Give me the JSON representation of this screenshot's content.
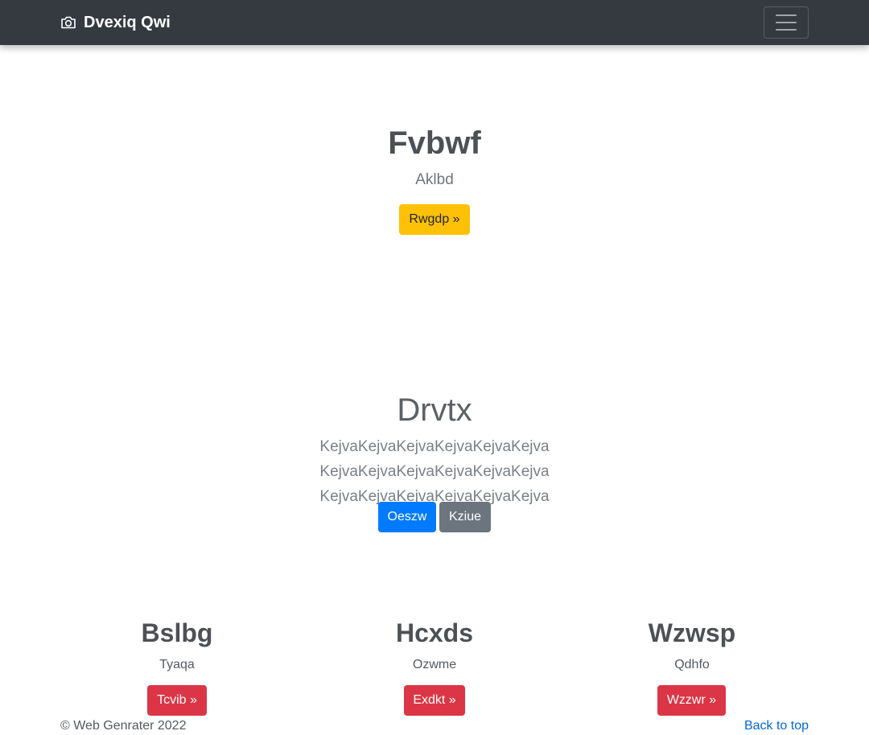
{
  "navbar": {
    "brand": "Dvexiq Qwi",
    "brand_icon": "camera-icon",
    "toggler_icon": "hamburger-menu-icon"
  },
  "hero": {
    "title": "Fvbwf",
    "subtitle": "Aklbd",
    "button": "Rwgdp »"
  },
  "jumbotron": {
    "title": "Drvtx",
    "lead": "KejvaKejvaKejvaKejvaKejvaKejva KejvaKejvaKejvaKejvaKejvaKejva KejvaKejvaKejvaKejvaKejvaKejva",
    "primary_button": "Oeszw",
    "secondary_button": "Kziue"
  },
  "columns": [
    {
      "title": "Bslbg",
      "subtitle": "Tyaqa",
      "button": "Tcvib »"
    },
    {
      "title": "Hcxds",
      "subtitle": "Ozwme",
      "button": "Exdkt »"
    },
    {
      "title": "Wzwsp",
      "subtitle": "Qdhfo",
      "button": "Wzzwr »"
    }
  ],
  "footer": {
    "copyright": "© Web Genrater 2022",
    "back_to_top": "Back to top"
  },
  "colors": {
    "navbar": "#343a40",
    "warning": "#ffc107",
    "primary": "#007bff",
    "secondary": "#6c757d",
    "danger": "#dc3545",
    "link": "#0069d9"
  }
}
